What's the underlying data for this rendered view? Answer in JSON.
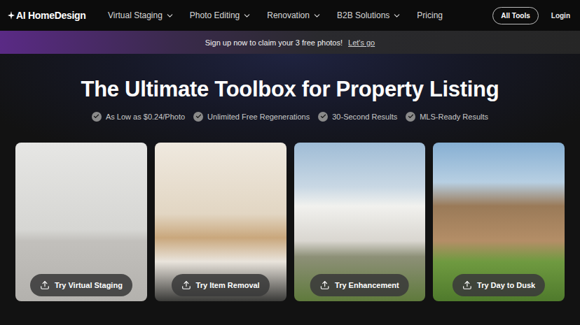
{
  "logo": {
    "text": "AI HomeDesign"
  },
  "nav": {
    "items": [
      {
        "label": "Virtual Staging",
        "dropdown": true
      },
      {
        "label": "Photo Editing",
        "dropdown": true
      },
      {
        "label": "Renovation",
        "dropdown": true
      },
      {
        "label": "B2B Solutions",
        "dropdown": true
      },
      {
        "label": "Pricing",
        "dropdown": false
      }
    ],
    "buttons": {
      "all_tools": "All Tools",
      "login": "Login"
    }
  },
  "banner": {
    "text": "Sign up now to claim your 3 free photos!",
    "link": "Let's go"
  },
  "hero": {
    "title": "The Ultimate Toolbox for Property Listing",
    "features": [
      "As Low as $0.24/Photo",
      "Unlimited Free Regenerations",
      "30-Second Results",
      "MLS-Ready Results"
    ]
  },
  "cards": [
    {
      "button": "Try Virtual Staging"
    },
    {
      "button": "Try Item Removal"
    },
    {
      "button": "Try Enhancement"
    },
    {
      "button": "Try Day to Dusk"
    }
  ]
}
